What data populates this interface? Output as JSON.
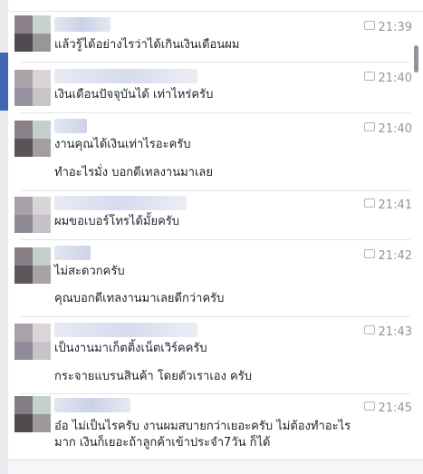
{
  "messages": [
    {
      "time": "21:39",
      "lines": [
        "แล้วรู้ได้อย่างไรว่าได้เกินเงินเดือนผม"
      ]
    },
    {
      "time": "21:40",
      "lines": [
        "เงินเดือนปัจจุบันได้ เท่าไหร่ครับ"
      ]
    },
    {
      "time": "21:40",
      "lines": [
        "งานคุณได้เงินเท่าไรอะครับ",
        "ทำอะไรมั่ง บอกดีเทลงานมาเลย"
      ]
    },
    {
      "time": "21:41",
      "lines": [
        "ผมขอเบอร์โทรได้มั้ยครับ"
      ]
    },
    {
      "time": "21:42",
      "lines": [
        "ไม่สะดวกครับ",
        "คุณบอกดีเทลงานมาเลยดีกว่าครับ"
      ]
    },
    {
      "time": "21:43",
      "lines": [
        "เป็นงานมาเก็ตติ้งเน็ตเวิร์คครับ",
        "กระจายแบรนสินค้า โดยตัวเราเอง ครับ"
      ]
    },
    {
      "time": "21:45",
      "lines": [
        "อ๋อ ไม่เป็นไรครับ งานผมสบายกว่าเยอะครับ ไม่ต้องทำอะไรมาก เงินก็เยอะถ้าลูกค้าเข้าประจำ7วัน ก็ได้"
      ]
    }
  ]
}
